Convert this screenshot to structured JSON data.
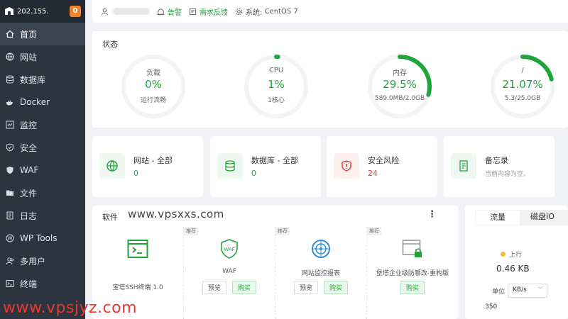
{
  "sidebar": {
    "server_ip": "202.155.",
    "badge": "0",
    "items": [
      {
        "label": "首页",
        "icon": "home-icon"
      },
      {
        "label": "网站",
        "icon": "globe-icon"
      },
      {
        "label": "数据库",
        "icon": "database-icon"
      },
      {
        "label": "Docker",
        "icon": "docker-icon"
      },
      {
        "label": "监控",
        "icon": "monitor-icon"
      },
      {
        "label": "安全",
        "icon": "shield-icon"
      },
      {
        "label": "WAF",
        "icon": "waf-icon"
      },
      {
        "label": "文件",
        "icon": "folder-icon"
      },
      {
        "label": "日志",
        "icon": "log-icon"
      },
      {
        "label": "WP Tools",
        "icon": "wordpress-icon"
      },
      {
        "label": "多用户",
        "icon": "users-icon"
      },
      {
        "label": "终端",
        "icon": "terminal-icon"
      }
    ]
  },
  "topbar": {
    "alert": "告警",
    "feedback": "需求反馈",
    "system": "系统:",
    "os": "CentOS 7"
  },
  "status": {
    "title": "状态",
    "gauges": [
      {
        "name": "负载",
        "value": "0%",
        "sub": "运行流畅",
        "fraction": 0.0
      },
      {
        "name": "CPU",
        "value": "1%",
        "sub": "1核心",
        "fraction": 0.01
      },
      {
        "name": "内存",
        "value": "29.5%",
        "sub": "589.0MB/2.0GB",
        "fraction": 0.295
      },
      {
        "name": "/",
        "value": "21.07%",
        "sub": "5.3/25.0GB",
        "fraction": 0.2107
      }
    ]
  },
  "overview": [
    {
      "title": "网站 - 全部",
      "value": "0",
      "icon": "globe-icon"
    },
    {
      "title": "数据库 - 全部",
      "value": "0",
      "icon": "database-icon"
    },
    {
      "title": "安全风险",
      "value": "24",
      "icon": "shield-alert-icon"
    },
    {
      "title": "备忘录",
      "value": "当前内容为空。",
      "icon": "memo-icon"
    }
  ],
  "software": {
    "title": "软件",
    "watermark": "www.vpsxxs.com",
    "more": "⋮",
    "items": [
      {
        "name": "宝塔SSH终端 1.0",
        "tag": ""
      },
      {
        "name": "WAF",
        "tag": "推荐",
        "preview": "预览",
        "buy": "购买"
      },
      {
        "name": "网站监控报表",
        "tag": "推荐",
        "preview": "预览",
        "buy": "购买"
      },
      {
        "name": "堡塔企业级防篡改-重构版",
        "tag": "推荐",
        "buy": "购买"
      }
    ]
  },
  "traffic": {
    "tabs": [
      "流量",
      "磁盘IO"
    ],
    "upload_label": "上行",
    "upload_value": "0.46 KB",
    "unit_label": "单位",
    "unit_value": "KB/s",
    "axis_top": "350"
  },
  "watermark2": "www.vpsjyz.com",
  "colors": {
    "accent": "#20a53a",
    "danger": "#e8382f",
    "sidebar_bg": "#2c3440"
  }
}
